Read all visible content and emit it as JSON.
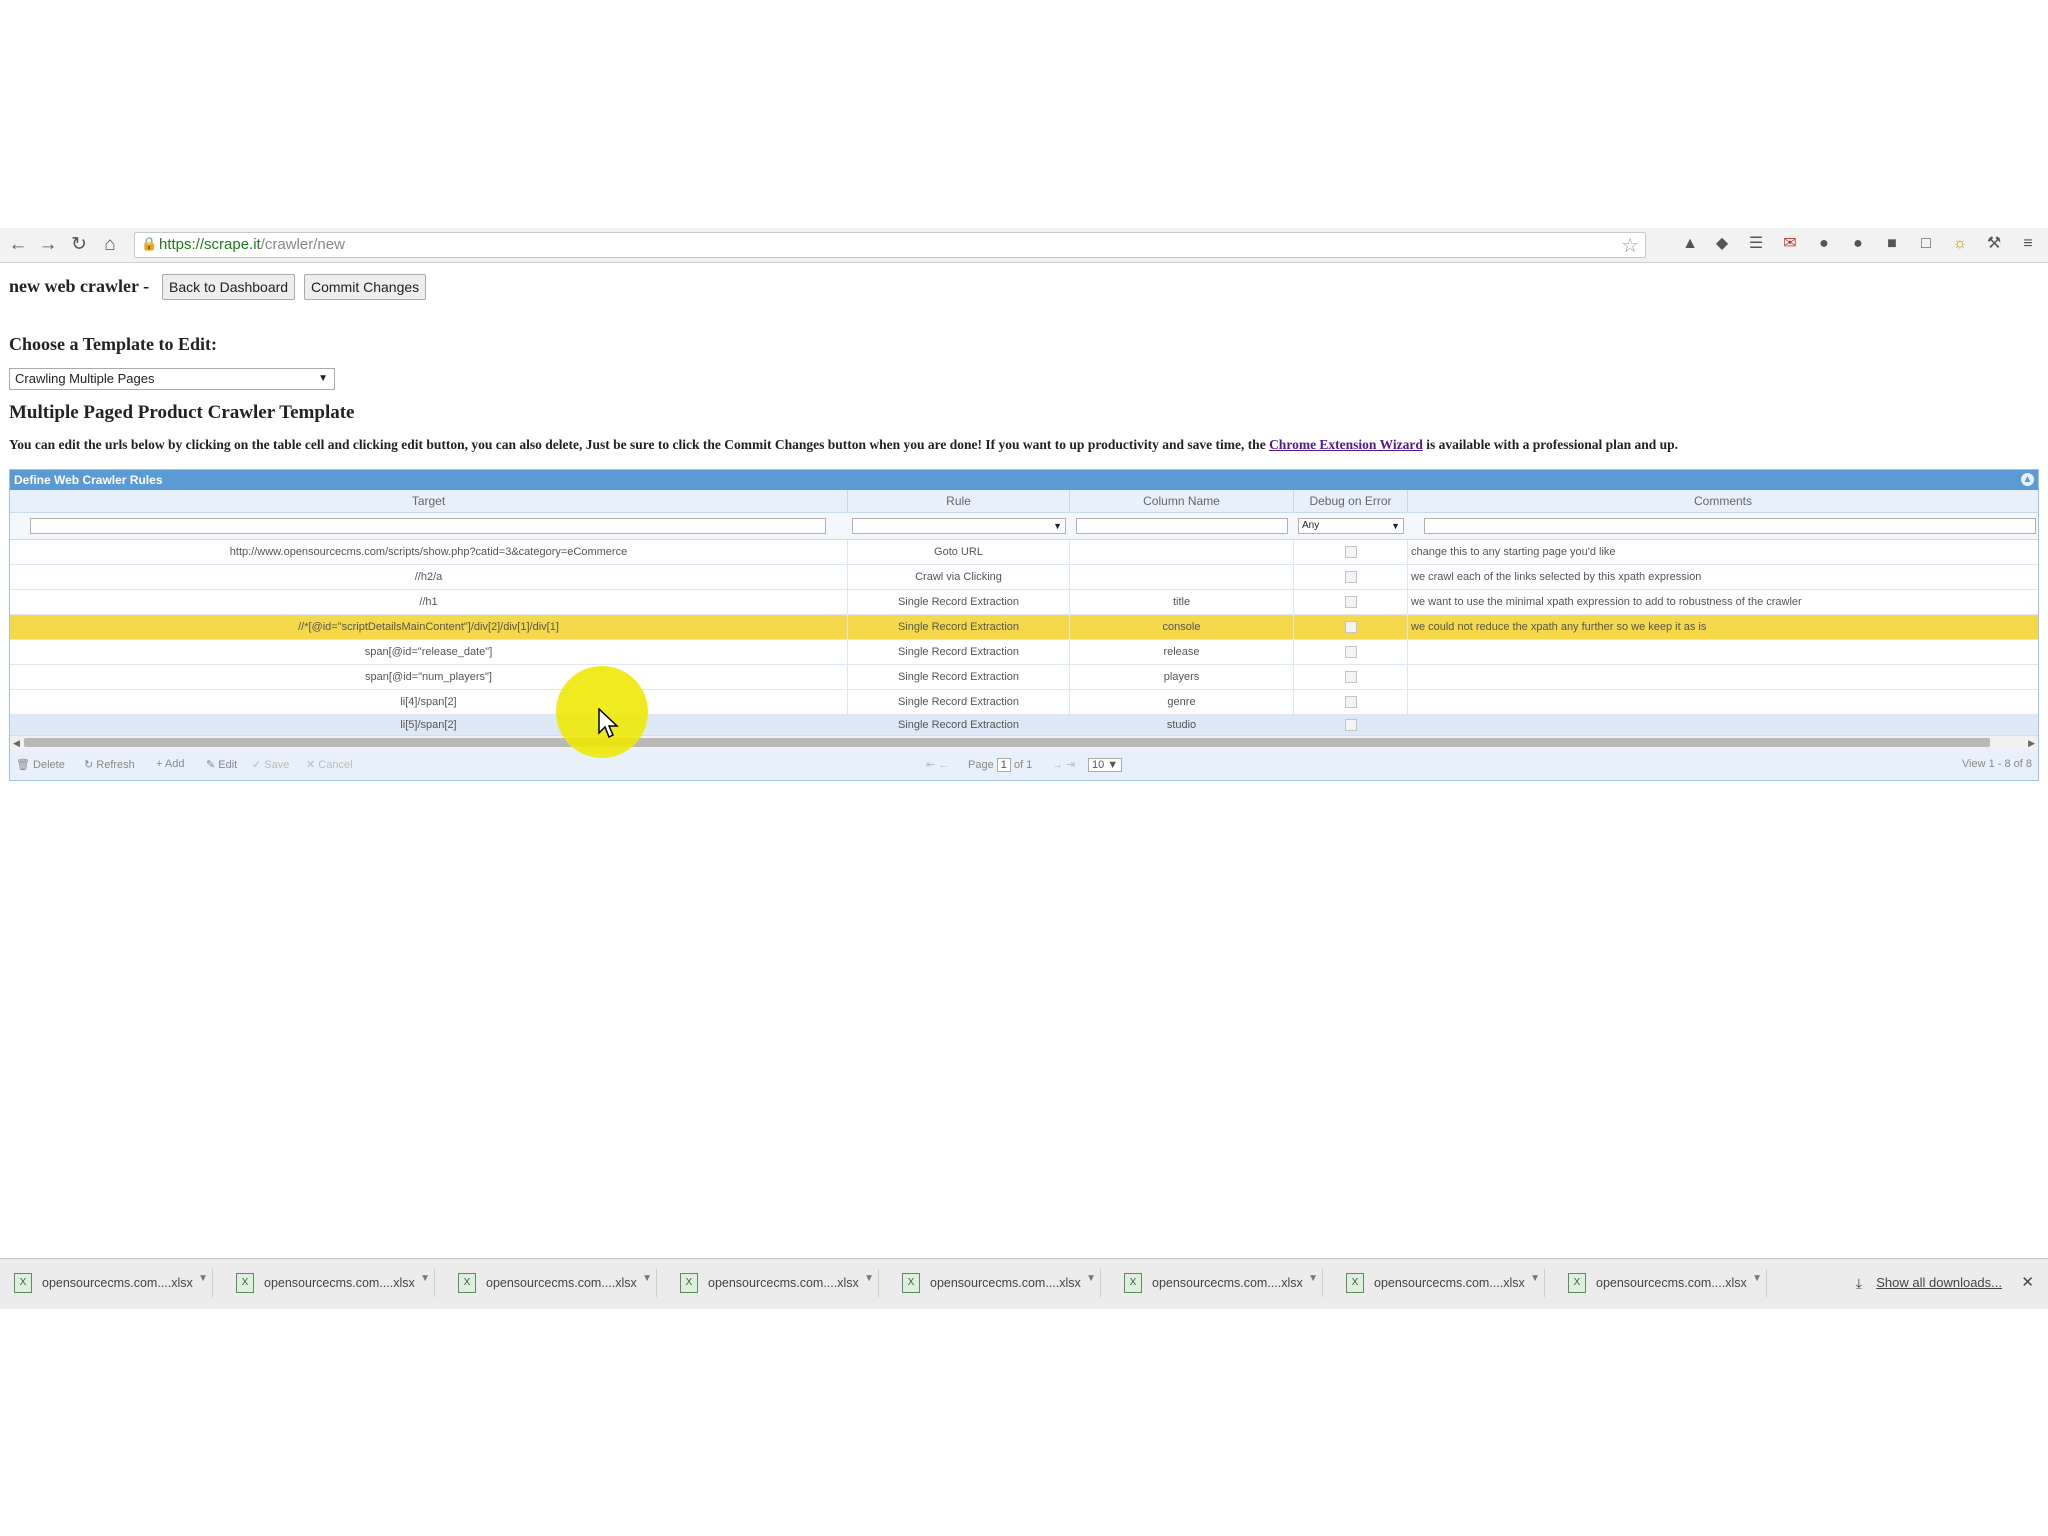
{
  "browser": {
    "url_host": "https://scrape.it",
    "url_path": "/crawler/new"
  },
  "page": {
    "crumb_title": "new web crawler",
    "crumb_sep": "-",
    "back_button": "Back to Dashboard",
    "commit_button": "Commit Changes",
    "choose_heading": "Choose a Template to Edit:",
    "template_selected": "Crawling Multiple Pages",
    "template_heading": "Multiple Paged Product Crawler Template",
    "instruction_pre": "You can edit the urls below by clicking on the table cell and clicking edit button, you can also delete, Just be sure to click the Commit Changes button when you are done! If you want to up productivity and save time, the",
    "instruction_link": "Chrome Extension Wizard",
    "instruction_post": "is available with a professional plan and up."
  },
  "grid": {
    "title": "Define Web Crawler Rules",
    "columns": [
      "Target",
      "Rule",
      "Column Name",
      "Debug on Error",
      "Comments"
    ],
    "debug_filter": "Any",
    "rows": [
      {
        "target": "http://www.opensourcecms.com/scripts/show.php?catid=3&category=eCommerce",
        "rule": "Goto URL",
        "column": "",
        "comment": "change this to any starting page you'd like"
      },
      {
        "target": "//h2/a",
        "rule": "Crawl via Clicking",
        "column": "",
        "comment": "we crawl each of the links selected by this xpath expression"
      },
      {
        "target": "//h1",
        "rule": "Single Record Extraction",
        "column": "title",
        "comment": "we want to use the minimal xpath expression to add to robustness of the crawler"
      },
      {
        "target": "//*[@id=\"scriptDetailsMainContent\"]/div[2]/div[1]/div[1]",
        "rule": "Single Record Extraction",
        "column": "console",
        "comment": "we could not reduce the xpath any further so we keep it as is"
      },
      {
        "target": "span[@id=\"release_date\"]",
        "rule": "Single Record Extraction",
        "column": "release",
        "comment": ""
      },
      {
        "target": "span[@id=\"num_players\"]",
        "rule": "Single Record Extraction",
        "column": "players",
        "comment": ""
      },
      {
        "target": "li[4]/span[2]",
        "rule": "Single Record Extraction",
        "column": "genre",
        "comment": ""
      },
      {
        "target": "li[5]/span[2]",
        "rule": "Single Record Extraction",
        "column": "studio",
        "comment": ""
      }
    ],
    "pager": {
      "delete": "Delete",
      "refresh": "Refresh",
      "add": "Add",
      "edit": "Edit",
      "save": "Save",
      "cancel": "Cancel",
      "page_label": "Page",
      "page_value": "1",
      "of_label": "of 1",
      "page_size": "10",
      "view_text": "View 1 - 8 of 8"
    }
  },
  "downloads": {
    "items": [
      "opensourcecms.com....xlsx",
      "opensourcecms.com....xlsx",
      "opensourcecms.com....xlsx",
      "opensourcecms.com....xlsx",
      "opensourcecms.com....xlsx",
      "opensourcecms.com....xlsx",
      "opensourcecms.com....xlsx",
      "opensourcecms.com....xlsx"
    ],
    "show_all": "Show all downloads..."
  }
}
